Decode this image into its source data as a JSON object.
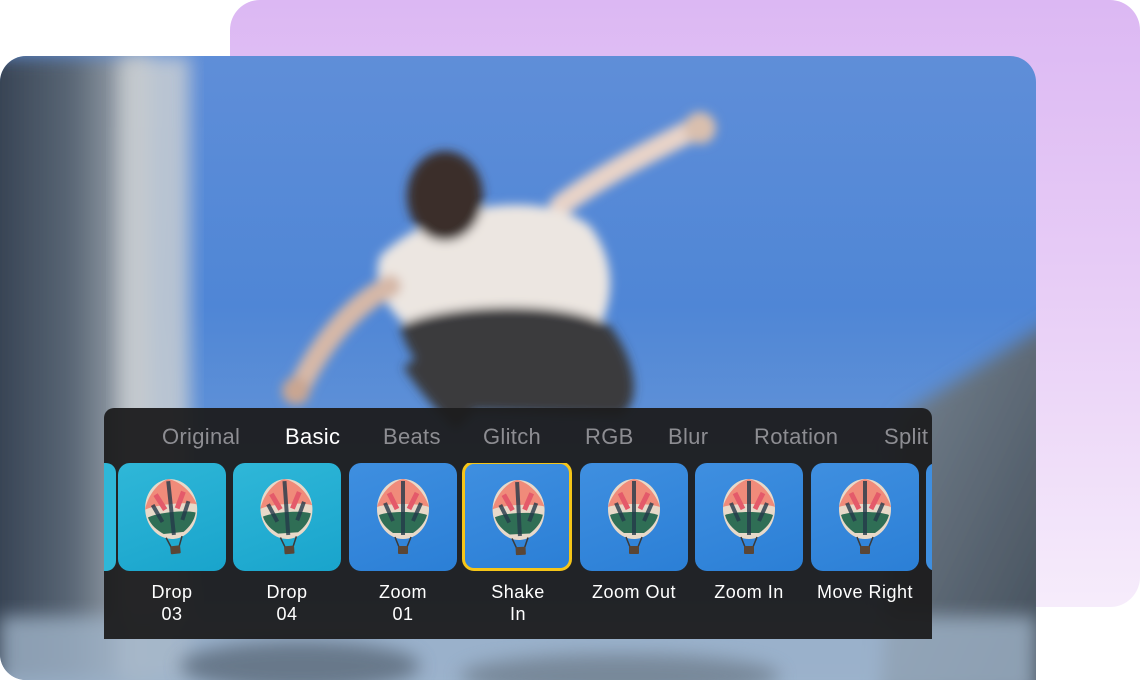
{
  "effects_panel": {
    "tabs": [
      {
        "label": "Original",
        "active": false
      },
      {
        "label": "Basic",
        "active": true
      },
      {
        "label": "Beats",
        "active": false
      },
      {
        "label": "Glitch",
        "active": false
      },
      {
        "label": "RGB",
        "active": false
      },
      {
        "label": "Blur",
        "active": false
      },
      {
        "label": "Rotation",
        "active": false
      },
      {
        "label": "Split",
        "active": false
      }
    ],
    "effects": [
      {
        "line1": "Drop",
        "line2": "03",
        "thumb_color": "teal",
        "selected": false
      },
      {
        "line1": "Drop",
        "line2": "04",
        "thumb_color": "teal",
        "selected": false
      },
      {
        "line1": "Zoom",
        "line2": "01",
        "thumb_color": "blue",
        "selected": false
      },
      {
        "line1": "Shake",
        "line2": "In",
        "thumb_color": "blue",
        "selected": true
      },
      {
        "line1": "Zoom Out",
        "line2": "",
        "thumb_color": "blue",
        "selected": false
      },
      {
        "line1": "Zoom In",
        "line2": "",
        "thumb_color": "blue",
        "selected": false
      },
      {
        "line1": "Move Right",
        "line2": "",
        "thumb_color": "blue",
        "selected": false
      }
    ],
    "selected_border_color": "#f5c518",
    "thumbnail_icon": "hot-air-balloon-icon"
  },
  "preview": {
    "subject": "skateboarder-jumping-photo",
    "background_accent": "#dcb8f3"
  }
}
